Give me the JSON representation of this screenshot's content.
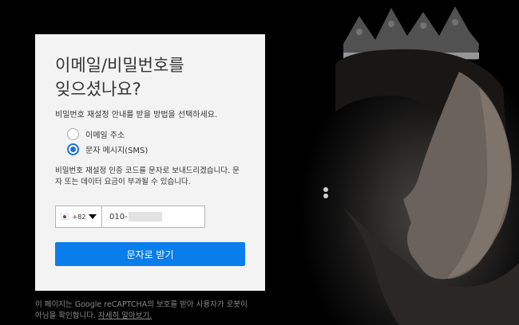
{
  "card": {
    "title_line1": "이메일/비밀번호를",
    "title_line2": "잊으셨나요?",
    "instructions": "비밀번호 재설정 안내를 받을 방법을 선택하세요."
  },
  "options": {
    "email_label": "이메일 주소",
    "sms_label": "문자 메시지(SMS)",
    "selected": "sms"
  },
  "sms_notice": "비밀번호 재설정 인증 코드를 문자로 보내드리겠습니다. 문자 또는 데이터 요금이 부과될 수 있습니다.",
  "phone": {
    "country_code": "+82",
    "number_visible": "010-"
  },
  "submit_label": "문자로 받기",
  "footer": {
    "text": "이 페이지는 Google reCAPTCHA의 보호를 받아 사용자가 로봇이 아님을 확인합니다.",
    "link": "자세히 알아보기."
  },
  "colors": {
    "accent": "#0a7ded",
    "card_bg": "#f3f3f3",
    "page_bg": "#000000"
  }
}
